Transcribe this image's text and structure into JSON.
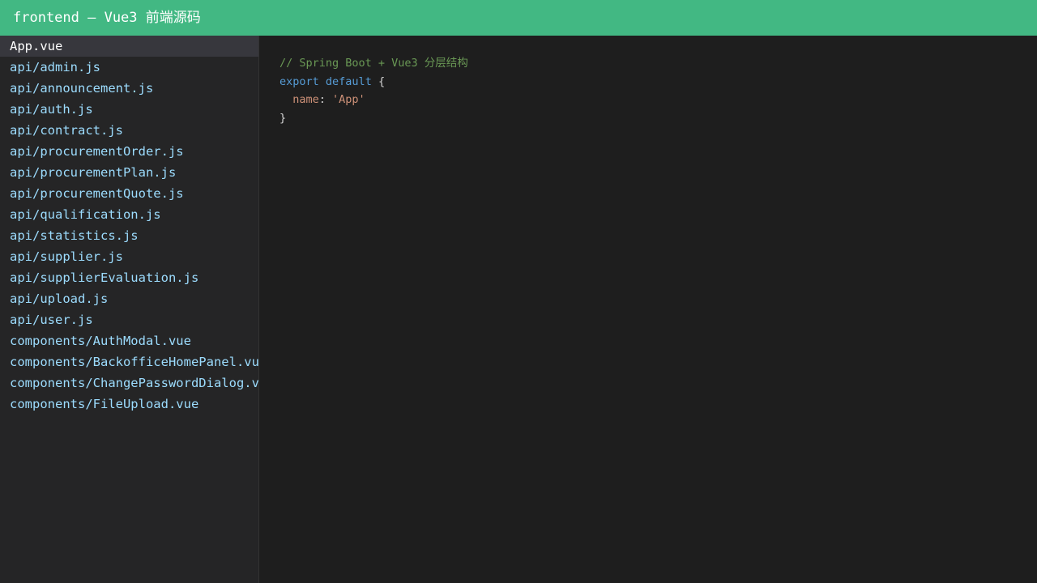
{
  "window": {
    "title": "frontend — Vue3 前端源码"
  },
  "sidebar": {
    "items": [
      {
        "label": "App.vue",
        "active": true
      },
      {
        "label": "api/admin.js"
      },
      {
        "label": "api/announcement.js"
      },
      {
        "label": "api/auth.js"
      },
      {
        "label": "api/contract.js"
      },
      {
        "label": "api/procurementOrder.js"
      },
      {
        "label": "api/procurementPlan.js"
      },
      {
        "label": "api/procurementQuote.js"
      },
      {
        "label": "api/qualification.js"
      },
      {
        "label": "api/statistics.js"
      },
      {
        "label": "api/supplier.js"
      },
      {
        "label": "api/supplierEvaluation.js"
      },
      {
        "label": "api/upload.js"
      },
      {
        "label": "api/user.js"
      },
      {
        "label": "components/AuthModal.vue"
      },
      {
        "label": "components/BackofficeHomePanel.vue"
      },
      {
        "label": "components/ChangePasswordDialog.vue"
      },
      {
        "label": "components/FileUpload.vue"
      }
    ]
  },
  "editor": {
    "comment": "// Spring Boot + Vue3 分层结构",
    "kw_export": "export",
    "kw_default": "default",
    "open_brace": "{",
    "indent": "  ",
    "prop_name": "name",
    "colon": ": ",
    "prop_value": "'App'",
    "close_brace": "}"
  },
  "colors": {
    "accent": "#42b883",
    "sidebar_bg": "#252526",
    "editor_bg": "#1e1e1e",
    "active_bg": "#37373d"
  }
}
